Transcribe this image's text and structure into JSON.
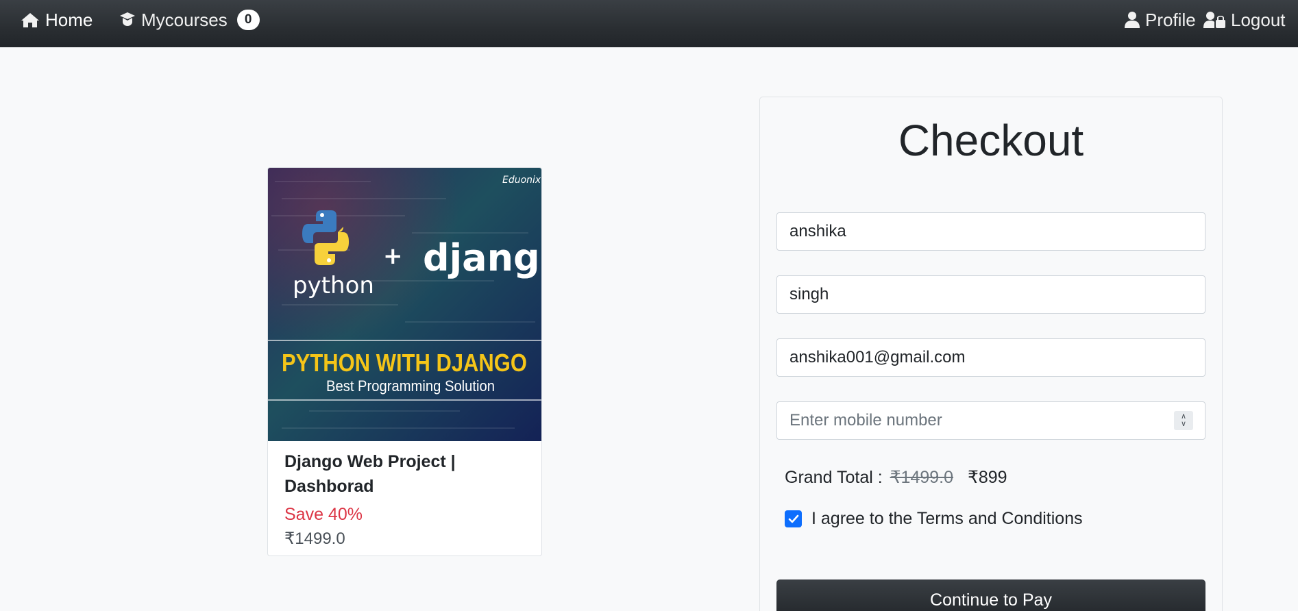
{
  "navbar": {
    "home_label": "Home",
    "courses_label": "Mycourses",
    "courses_count": "0",
    "profile_label": "Profile",
    "logout_label": "Logout"
  },
  "course": {
    "image": {
      "brand": "Eduonix",
      "python_text": "python",
      "plus": "+",
      "django_text": "django",
      "headline": "PYTHON WITH DJANGO",
      "subheadline": "Best Programming Solution"
    },
    "title": "Django Web Project | Dashborad",
    "save": "Save 40%",
    "price": "₹1499.0"
  },
  "checkout": {
    "title": "Checkout",
    "first_name": "anshika",
    "last_name": "singh",
    "email": "anshika001@gmail.com",
    "mobile_placeholder": "Enter mobile number",
    "grand_total_label": "Grand Total :",
    "old_price": "₹1499.0",
    "new_price": "₹899",
    "terms_label": "I agree to the Terms and Conditions",
    "terms_checked": true,
    "pay_button": "Continue to Pay"
  },
  "colors": {
    "navbar": "#212529",
    "accent": "#0d6efd",
    "save": "#dc3545",
    "headline": "#f5c518"
  },
  "icons": [
    "home-icon",
    "graduation-cap-icon",
    "user-icon",
    "user-lock-icon",
    "check-icon",
    "python-logo-icon"
  ]
}
